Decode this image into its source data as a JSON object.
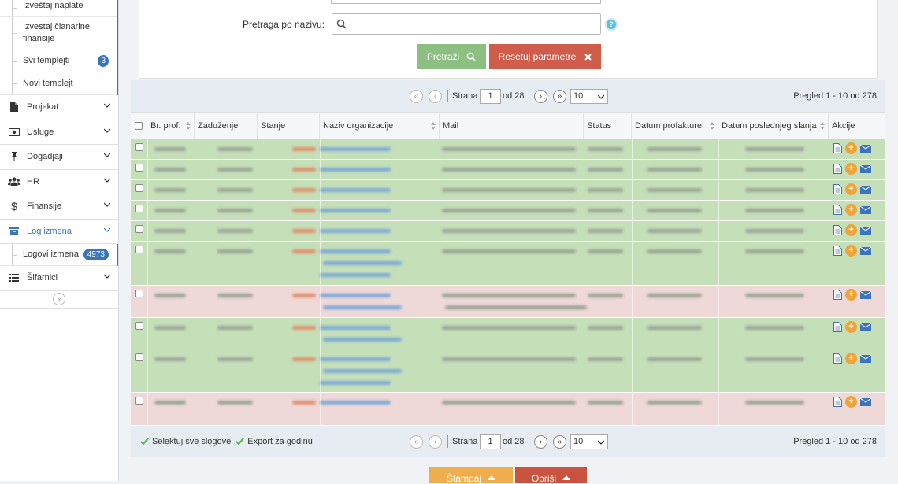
{
  "sidebar": {
    "sub_items_top": [
      {
        "label": "Izveštaj naplate"
      },
      {
        "label": "Izvestaj članarine finansije"
      },
      {
        "label": "Svi templejti",
        "badge": "3"
      },
      {
        "label": "Novi templejt"
      }
    ],
    "menu": [
      {
        "label": "Projekat",
        "icon": "document-icon"
      },
      {
        "label": "Usluge",
        "icon": "money-icon"
      },
      {
        "label": "Dogadjaji",
        "icon": "pin-icon"
      },
      {
        "label": "HR",
        "icon": "users-icon"
      },
      {
        "label": "Finansije",
        "icon": "dollar-icon"
      },
      {
        "label": "Log izmena",
        "icon": "log-icon",
        "active": true
      }
    ],
    "log_sub": {
      "label": "Logovi izmena",
      "badge": "4973"
    },
    "sifarnici": {
      "label": "Šifarnici",
      "icon": "list-icon"
    },
    "collapse_symbol": "«"
  },
  "search": {
    "label": "Pretraga po nazivu:",
    "value": "",
    "search_button": "Pretraži",
    "reset_button": "Resetuj parametre",
    "help_symbol": "?"
  },
  "pager": {
    "page_label": "Strana",
    "page_value": "1",
    "of_label": "od 28",
    "page_size": "10",
    "info": "Pregled 1 - 10 od 278",
    "first_symbol": "«",
    "prev_symbol": "‹",
    "next_symbol": "›",
    "last_symbol": "»"
  },
  "grid": {
    "columns": [
      "Br. prof.",
      "Zaduženje",
      "Stanje",
      "Naziv organizacije",
      "Mail",
      "Status",
      "Datum profakture",
      "Datum poslednjeg slanja",
      "Akcije"
    ]
  },
  "footer": {
    "select_all": "Selektuj sve slogove",
    "export": "Export za godinu",
    "print_button": "Štampaj",
    "delete_button": "Obriši"
  },
  "colors": {
    "accent": "#3b74b8",
    "search_btn": "#8dbf82",
    "reset_btn": "#d05c4c",
    "row_green": "#c5dfb9",
    "row_pink": "#efd8d8",
    "print_btn": "#f0ad4e",
    "delete_btn": "#c9533f"
  }
}
